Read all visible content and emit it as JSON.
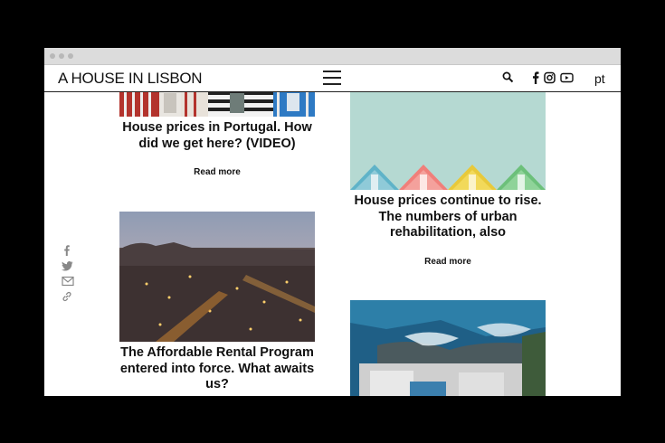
{
  "site": {
    "logo": "A HOUSE IN LISBON",
    "language": "pt"
  },
  "header_icons": [
    "search-icon",
    "facebook-icon",
    "instagram-icon",
    "youtube-icon"
  ],
  "share_icons": [
    "facebook-icon",
    "twitter-icon",
    "email-icon",
    "link-icon"
  ],
  "articles": [
    {
      "title": "House prices in Portugal. How did we get here? (VIDEO)",
      "read_more": "Read more"
    },
    {
      "title": "House prices continue to rise. The numbers of urban rehabilitation, also",
      "read_more": "Read more"
    },
    {
      "title": "The Affordable Rental Program entered into force. What awaits us?"
    }
  ]
}
